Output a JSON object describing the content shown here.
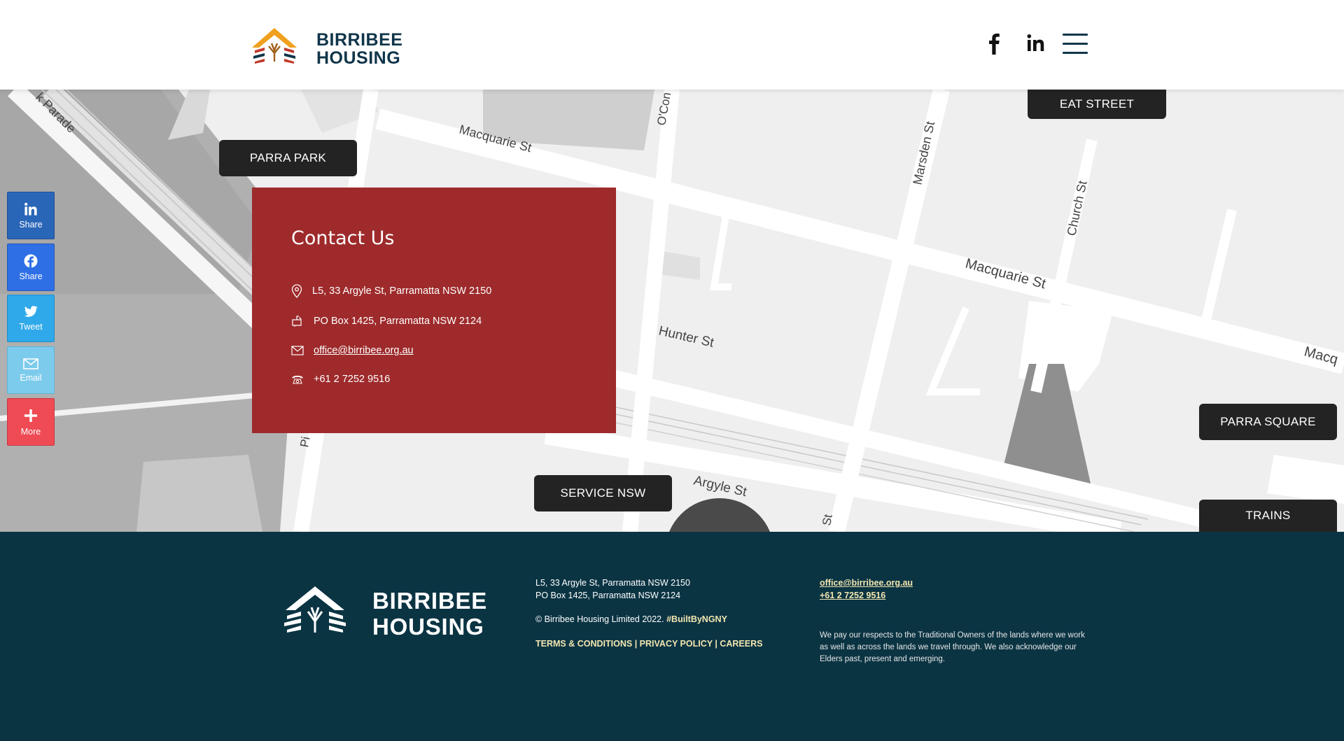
{
  "header": {
    "brand_line1": "BIRRIBEE",
    "brand_line2": "HOUSING",
    "icons": [
      "facebook-icon",
      "linkedin-icon",
      "hamburger-menu-icon"
    ]
  },
  "map": {
    "streets": [
      "Macquarie St",
      "Macquarie St",
      "Macq",
      "Marsden St",
      "Church St",
      "Hunter St",
      "Argyle St",
      "O'Con",
      "k Parade",
      "Pi",
      "St"
    ],
    "pins": {
      "eat_street": "EAT STREET",
      "parra_park": "PARRA PARK",
      "parra_square": "PARRA SQUARE",
      "service_nsw": "SERVICE NSW",
      "trains": "TRAINS"
    }
  },
  "contact": {
    "title": "Contact Us",
    "address": "L5, 33 Argyle St, Parramatta NSW 2150",
    "po_box": "PO Box 1425, Parramatta NSW 2124",
    "email": "office@birribee.org.au",
    "phone": "+61 2 7252 9516",
    "colors": {
      "card": "#9e2a2b"
    }
  },
  "share_bar": {
    "linkedin": "Share",
    "facebook": "Share",
    "twitter": "Tweet",
    "email": "Email",
    "more": "More"
  },
  "footer": {
    "brand_line1": "BIRRIBEE",
    "brand_line2": "HOUSING",
    "address": "L5, 33 Argyle St, Parramatta NSW 2150",
    "po_box": "PO Box 1425, Parramatta NSW 2124",
    "copyright": "© Birribee Housing Limited 2022.",
    "built_by": "#BuiltByNGNY",
    "links": {
      "terms": "TERMS & CONDITIONS",
      "privacy": "PRIVACY POLICY",
      "careers": "CAREERS",
      "separator": "|"
    },
    "email": "office@birribee.org.au",
    "phone": "+61 2 7252 9516",
    "acknowledgement": "We pay our respects to the Traditional Owners of the lands where we work as well as across the lands we travel through. We also acknowledge our Elders past, present and emerging.",
    "colors": {
      "background": "#0b3443",
      "accent": "#f2e6b0"
    }
  }
}
